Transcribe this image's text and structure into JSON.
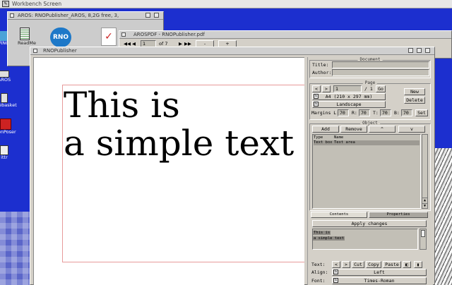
{
  "screen": {
    "title": "Workbench Screen"
  },
  "desktop_icons": [
    {
      "label": "RNO"
    },
    {
      "label": "AROS"
    },
    {
      "label": "astebasket"
    },
    {
      "label": "conPoser"
    },
    {
      "label": "ittr"
    }
  ],
  "aros_window": {
    "title": "AROS: RNOPublisher_AROS, 8,2G free, 3,",
    "icon_label": "ReadMe"
  },
  "pdf_window": {
    "title": "AROSPDF - RNOPublisher.pdf",
    "page_current": "1",
    "page_total": "of 7",
    "zoom_out": "-",
    "zoom_in": "+"
  },
  "rno_window": {
    "title": "RNOPublisher"
  },
  "canvas": {
    "line1": "This is",
    "line2": "a simple text"
  },
  "document": {
    "group": "Document",
    "title_label": "Title:",
    "title_value": "",
    "author_label": "Author:",
    "author_value": ""
  },
  "page": {
    "group": "Page",
    "prev": "<",
    "next": ">",
    "current": "1",
    "total": "/ 1",
    "go": "Go",
    "size": "A4 (210 x 297 mm)",
    "orientation": "Landscape",
    "new": "New",
    "delete": "Delete",
    "margins_label": "Margins L:",
    "margin_l": "70",
    "r_label": "R:",
    "margin_r": "70",
    "t_label": "T:",
    "margin_t": "70",
    "b_label": "B:",
    "margin_b": "70",
    "set": "Set"
  },
  "object": {
    "group": "Object",
    "add": "Add",
    "remove": "Remove",
    "up": "^",
    "down": "v",
    "col_type": "Type",
    "col_name": "Name",
    "rows": [
      {
        "type": "Text box",
        "name": "Text area"
      }
    ]
  },
  "tabs": {
    "contents": "Contents",
    "properties": "Properties"
  },
  "contents": {
    "apply": "Apply changes",
    "text_line1": "This is",
    "text_line2": "a simple text",
    "text_label": "Text:",
    "tprev": "<",
    "tnext": ">",
    "cut": "Cut",
    "copy": "Copy",
    "paste": "Paste",
    "align_label": "Align:",
    "align_value": "Left",
    "font_label": "Font:",
    "font_value": "Times-Roman"
  },
  "colors": {
    "desktop": "#1c2fcf",
    "accent_red": "#cc2222"
  }
}
